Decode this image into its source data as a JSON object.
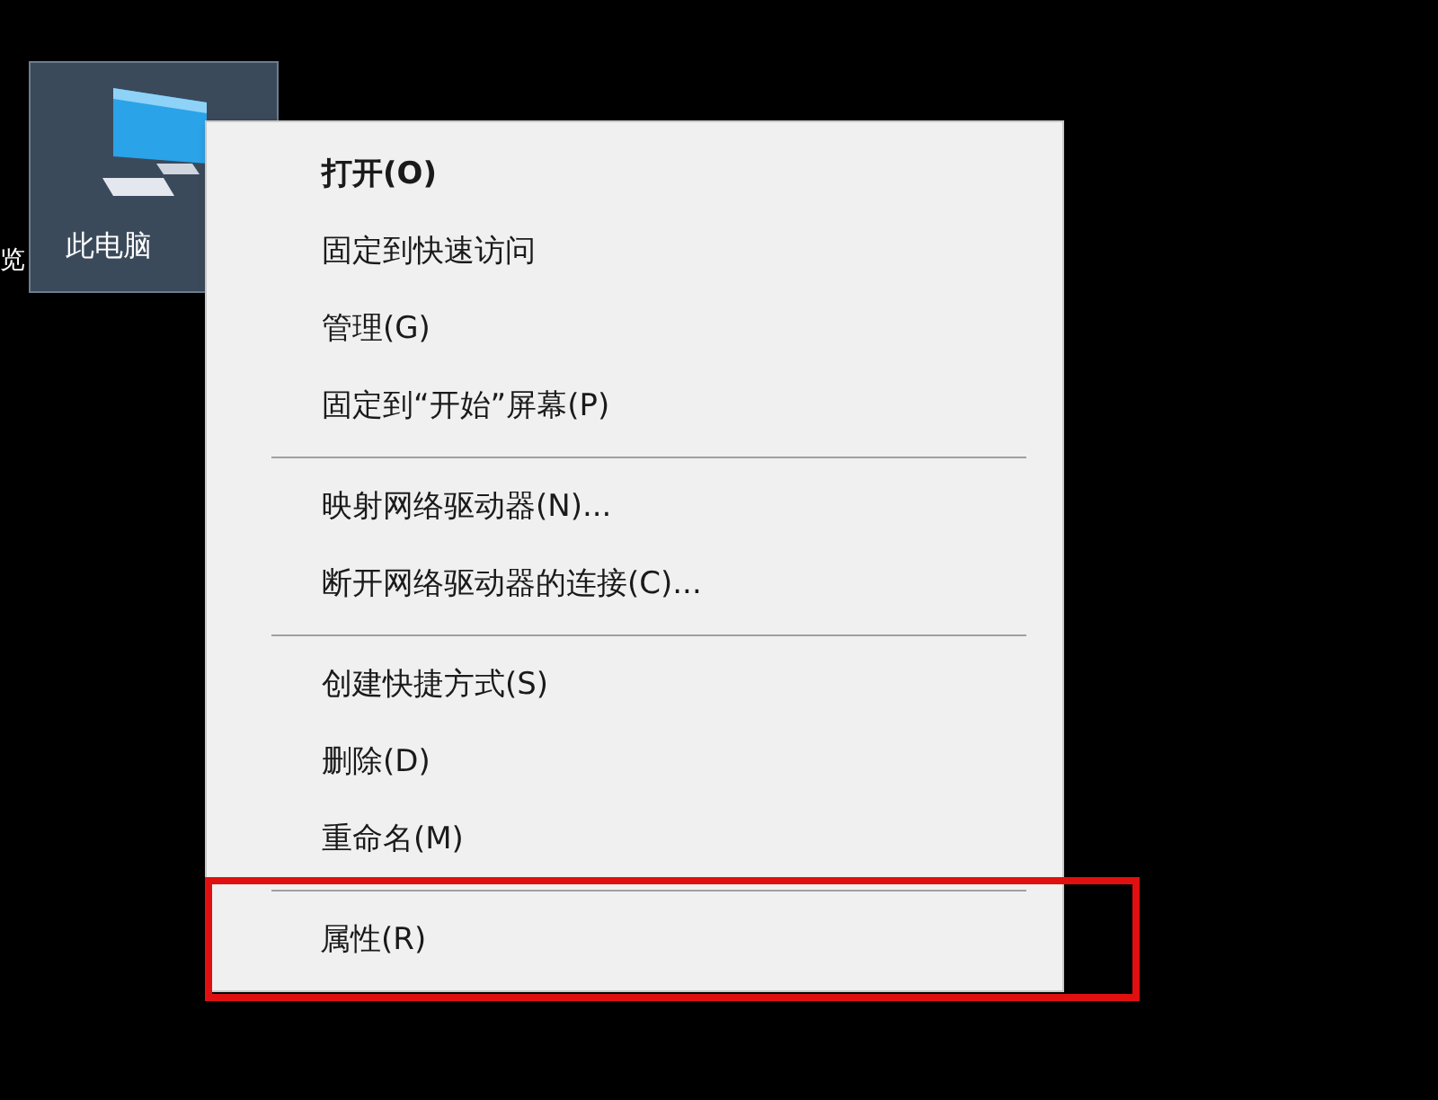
{
  "desktop": {
    "icons": [
      {
        "label": "览",
        "kind": "text-only",
        "selected": false
      },
      {
        "label": "此电脑",
        "kind": "computer",
        "selected": true
      }
    ]
  },
  "context_menu": {
    "groups": [
      [
        {
          "label": "打开(O)",
          "default": true
        },
        {
          "label": "固定到快速访问",
          "default": false
        },
        {
          "label": "管理(G)",
          "default": false
        },
        {
          "label": "固定到“开始”屏幕(P)",
          "default": false
        }
      ],
      [
        {
          "label": "映射网络驱动器(N)...",
          "default": false
        },
        {
          "label": "断开网络驱动器的连接(C)...",
          "default": false
        }
      ],
      [
        {
          "label": "创建快捷方式(S)",
          "default": false
        },
        {
          "label": "删除(D)",
          "default": false
        },
        {
          "label": "重命名(M)",
          "default": false
        }
      ],
      [
        {
          "label": "属性(R)",
          "default": false,
          "highlighted": true
        }
      ]
    ]
  }
}
